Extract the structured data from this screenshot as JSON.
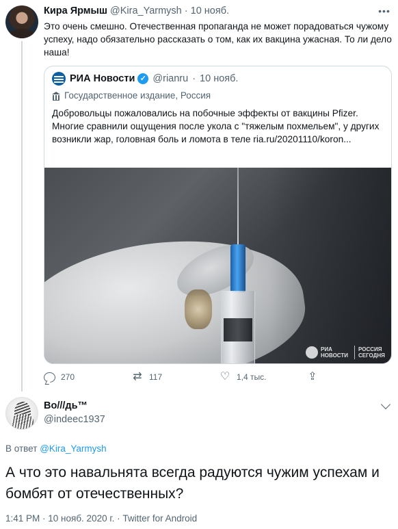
{
  "tweet1": {
    "author_name": "Кира Ярмыш",
    "handle": "@Kira_Yarmysh",
    "date": "10 нояб.",
    "separator": "·",
    "text": "Это очень смешно. Отечественная пропаганда не может порадоваться чужому успеху, надо обязательно рассказать о том, как их вакцина ужасная. То ли дело наша!",
    "quote": {
      "author_name": "РИА Новости",
      "handle": "@rianru",
      "date": "10 нояб.",
      "label": "Государственное издание, Россия",
      "text": "Добровольцы пожаловались на побочные эффекты от вакцины Pfizer. Многие сравнили ощущения после укола с \"тяжелым похмельем\", у других возникли жар, головная боль и ломота в теле ria.ru/20201110/koron...",
      "watermark_left": "РИА НОВОСТИ",
      "watermark_right": "РОССИЯ СЕГОДНЯ"
    },
    "actions": {
      "replies": "270",
      "retweets": "117",
      "likes": "1,4 тыс."
    }
  },
  "tweet2": {
    "author_name": "Во///дь™",
    "handle": "@indeec1937",
    "reply_prefix": "В ответ",
    "reply_handle": "@Kira_Yarmysh",
    "text": "А что это навальнята всегда радуются чужим успехам и бомбят от отечественных?",
    "footer": "1:41 PM · 10 нояб. 2020 г. · Twitter for Android"
  },
  "icons": {
    "reply": "reply-icon",
    "retweet": "retweet-icon",
    "like": "heart-icon",
    "share": "share-icon",
    "more": "more-icon",
    "verified": "verified-icon",
    "government": "government-icon",
    "chevron": "chevron-down-icon"
  },
  "colors": {
    "text": "#0f1419",
    "secondary": "#536471",
    "link": "#1d9bf0",
    "border": "#cfd9de"
  }
}
